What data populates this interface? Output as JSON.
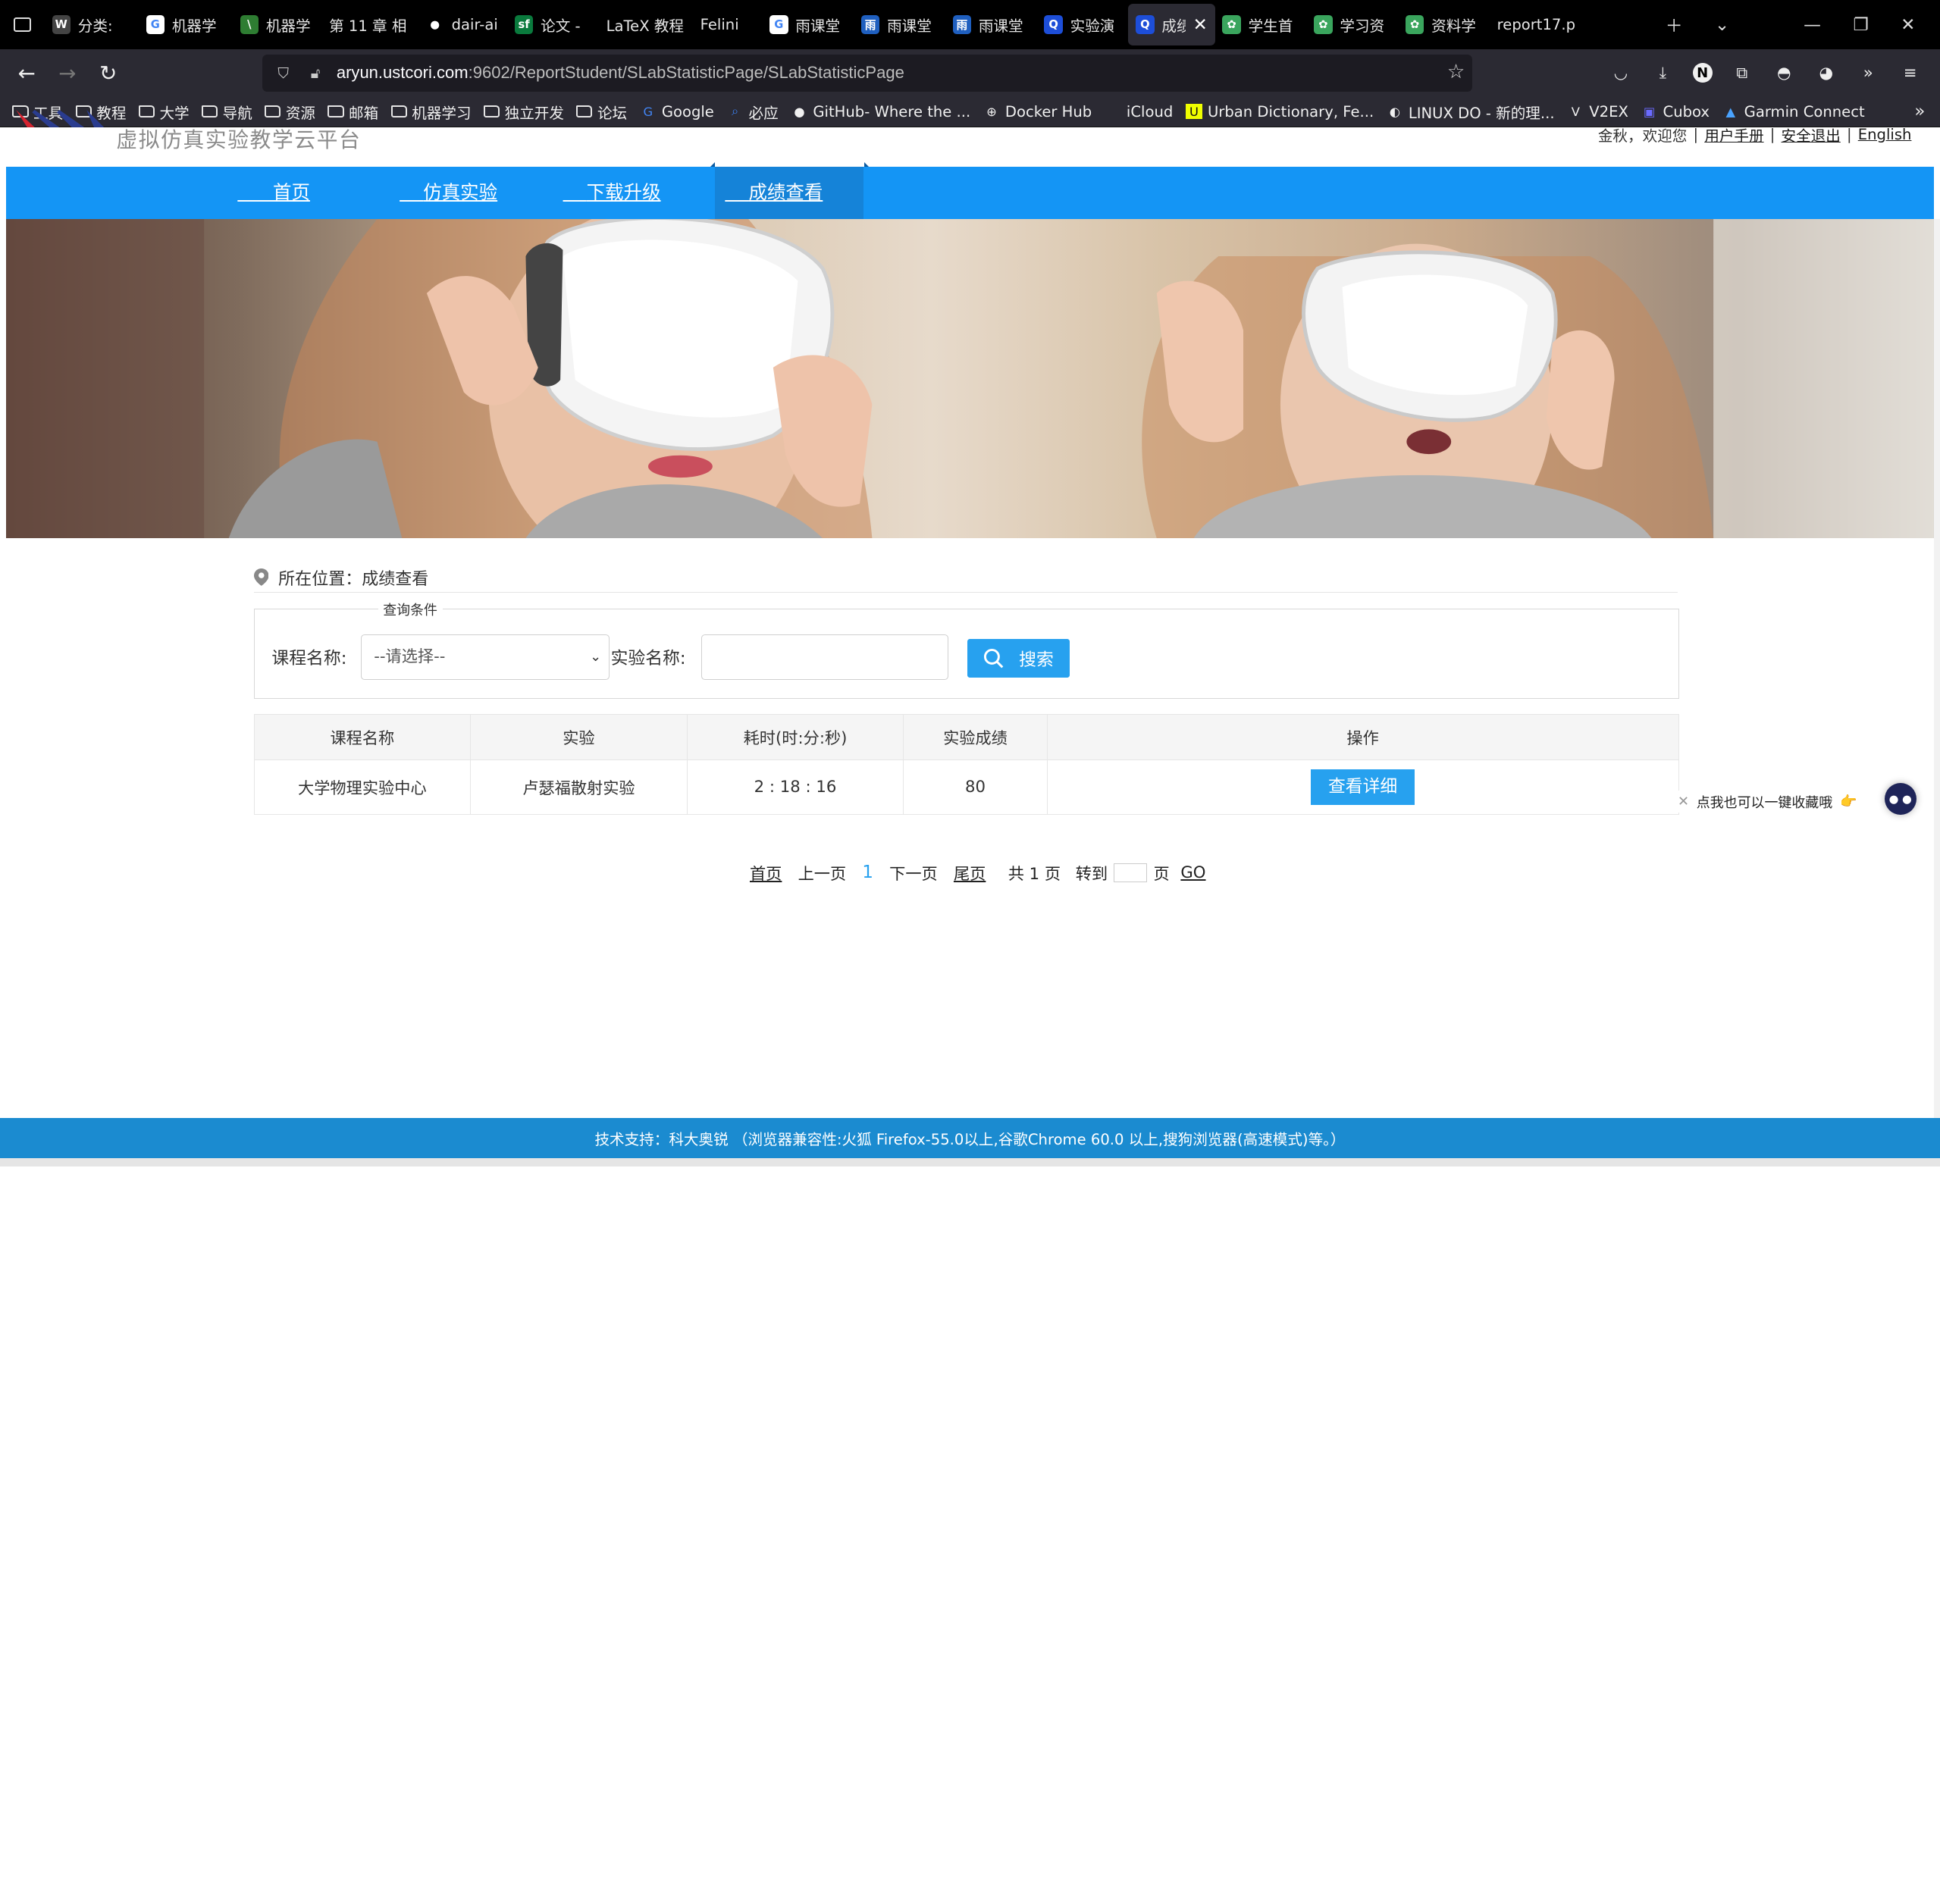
{
  "browser": {
    "tabs": [
      {
        "label": "分类:",
        "icon": "wiki-icon",
        "color": "#444444",
        "glyph": "W",
        "active": false
      },
      {
        "label": "机器学",
        "icon": "google-icon",
        "color": "#4285f4",
        "glyph": "G",
        "active": false
      },
      {
        "label": "机器学",
        "icon": "leaf-icon",
        "color": "#2e7d32",
        "glyph": "\\",
        "active": false
      },
      {
        "label": "第 11 章 相",
        "icon": "",
        "color": "",
        "glyph": "",
        "active": false
      },
      {
        "label": "dair-ai",
        "icon": "github-icon",
        "color": "#000000",
        "glyph": "●",
        "active": false
      },
      {
        "label": "论文 -",
        "icon": "sf-icon",
        "color": "#0a7a3d",
        "glyph": "sf",
        "active": false
      },
      {
        "label": "LaTeX 教程",
        "icon": "",
        "color": "",
        "glyph": "",
        "active": false
      },
      {
        "label": "Felini",
        "icon": "",
        "color": "",
        "glyph": "",
        "active": false
      },
      {
        "label": "雨课堂",
        "icon": "google-icon",
        "color": "#4285f4",
        "glyph": "G",
        "active": false
      },
      {
        "label": "雨课堂",
        "icon": "rain-icon",
        "color": "#1f5fbf",
        "glyph": "雨",
        "active": false
      },
      {
        "label": "雨课堂",
        "icon": "rain-icon",
        "color": "#1f5fbf",
        "glyph": "雨",
        "active": false
      },
      {
        "label": "实验演",
        "icon": "search-doc-icon",
        "color": "#1d4ed8",
        "glyph": "Q",
        "active": false
      },
      {
        "label": "成绩",
        "icon": "search-doc-icon",
        "color": "#1d4ed8",
        "glyph": "Q",
        "active": true
      },
      {
        "label": "学生首",
        "icon": "lab-icon",
        "color": "#3aa55d",
        "glyph": "✿",
        "active": false
      },
      {
        "label": "学习资",
        "icon": "lab-icon",
        "color": "#3aa55d",
        "glyph": "✿",
        "active": false
      },
      {
        "label": "资料学",
        "icon": "lab-icon",
        "color": "#3aa55d",
        "glyph": "✿",
        "active": false
      },
      {
        "label": "report17.p",
        "icon": "",
        "color": "",
        "glyph": "",
        "active": false
      }
    ],
    "url_domain": "aryun.ustcori.com",
    "url_rest": ":9602/ReportStudent/SLabStatisticPage/SLabStatisticPage",
    "bookmarks": [
      {
        "label": "工具",
        "icon": "folder-icon"
      },
      {
        "label": "教程",
        "icon": "folder-icon"
      },
      {
        "label": "大学",
        "icon": "folder-icon"
      },
      {
        "label": "导航",
        "icon": "folder-icon"
      },
      {
        "label": "资源",
        "icon": "folder-icon"
      },
      {
        "label": "邮箱",
        "icon": "folder-icon"
      },
      {
        "label": "机器学习",
        "icon": "folder-icon"
      },
      {
        "label": "独立开发",
        "icon": "folder-icon"
      },
      {
        "label": "论坛",
        "icon": "folder-icon"
      },
      {
        "label": "Google",
        "icon": "google-icon"
      },
      {
        "label": "必应",
        "icon": "bing-icon"
      },
      {
        "label": "GitHub- Where the ...",
        "icon": "github-icon"
      },
      {
        "label": "Docker Hub",
        "icon": "globe-icon"
      },
      {
        "label": "iCloud",
        "icon": "apple-icon"
      },
      {
        "label": "Urban Dictionary, Fe...",
        "icon": "urban-icon"
      },
      {
        "label": "LINUX DO - 新的理...",
        "icon": "linuxdo-icon"
      },
      {
        "label": "V2EX",
        "icon": "v2ex-icon"
      },
      {
        "label": "Cubox",
        "icon": "cubox-icon"
      },
      {
        "label": "Garmin Connect",
        "icon": "garmin-icon"
      }
    ],
    "n_avatar": "N"
  },
  "site": {
    "title": "虚拟仿真实验教学云平台",
    "user": "金秋，欢迎您",
    "links": [
      "用户手册",
      "安全退出",
      "English"
    ]
  },
  "nav": [
    {
      "label": "首页",
      "active": false
    },
    {
      "label": "仿真实验",
      "active": false
    },
    {
      "label": "下载升级",
      "active": false
    },
    {
      "label": "成绩查看",
      "active": true
    }
  ],
  "breadcrumb": {
    "prefix": "所在位置：",
    "current": "成绩查看"
  },
  "query": {
    "legend": "查询条件",
    "course_label": "课程名称:",
    "course_value": "--请选择--",
    "exp_label": "实验名称:",
    "exp_value": "",
    "search_label": "搜索"
  },
  "table": {
    "headers": [
      "课程名称",
      "实验",
      "耗时(时:分:秒)",
      "实验成绩",
      "操作"
    ],
    "rows": [
      {
        "course": "大学物理实验中心",
        "experiment": "卢瑟福散射实验",
        "duration": "2 : 18 : 16",
        "score": "80",
        "action": "查看详细"
      }
    ]
  },
  "pager": {
    "first": "首页",
    "prev": "上一页",
    "current": "1",
    "next": "下一页",
    "last": "尾页",
    "total": "共 1 页",
    "goto": "转到",
    "page_unit": "页",
    "go": "GO"
  },
  "float": {
    "tip": "点我也可以一键收藏哦",
    "emoji": "👉"
  },
  "footer": {
    "text": "技术支持：科大奥锐 （浏览器兼容性:火狐 Firefox-55.0以上,谷歌Chrome 60.0 以上,搜狗浏览器(高速模式)等。）"
  },
  "colors": {
    "nav_blue": "#1495f5",
    "accent": "#27a1ef",
    "footer": "#1b8bd0"
  }
}
